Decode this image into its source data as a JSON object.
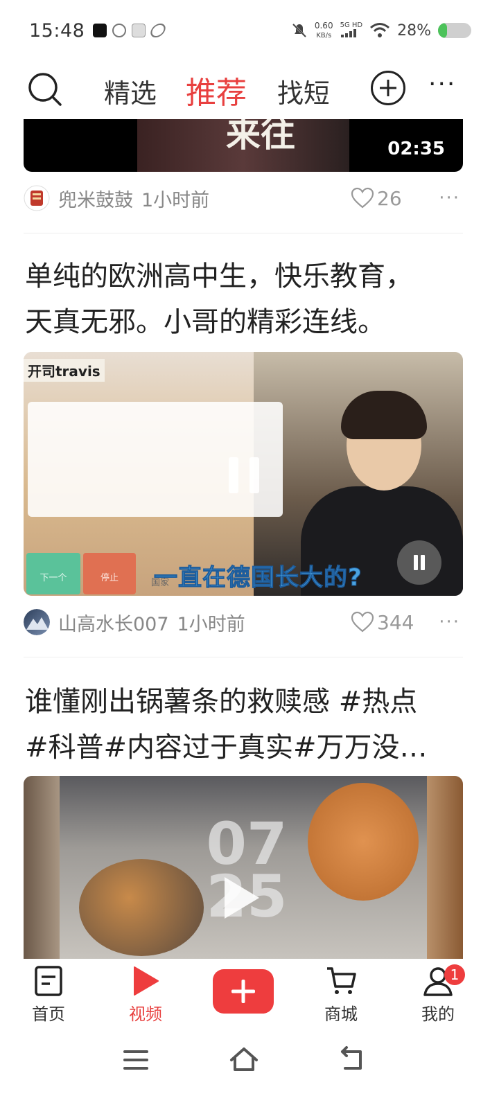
{
  "status_bar": {
    "time": "15:48",
    "net_speed": "0.60",
    "net_unit": "KB/s",
    "network": "5G HD",
    "battery": "28%"
  },
  "top_nav": {
    "tabs": [
      "精选",
      "推荐",
      "找短"
    ],
    "active_tab": "推荐",
    "icons": [
      "search-icon",
      "add-circle-icon",
      "more-icon"
    ]
  },
  "feed": [
    {
      "duration": "02:35",
      "thumb_text": "来往",
      "author": "兜米鼓鼓",
      "time": "1小时前",
      "likes": "26"
    },
    {
      "title_line1": "单纯的欧洲高中生，快乐教育，",
      "title_line2": "天真无邪。小哥的精彩连线。",
      "channel_tag": "开司travis",
      "subtitle": "一直在德国长大的?",
      "btn_next": "下一个",
      "btn_stop": "停止",
      "country_label": "国家",
      "author": "山高水长007",
      "time": "1小时前",
      "likes": "344"
    },
    {
      "title_line1": "谁懂刚出锅薯条的救赎感 #热点",
      "title_line2": "#科普#内容过于真实#万万没…",
      "overlay_number": "07 25"
    }
  ],
  "tabbar": {
    "items": [
      {
        "label": "首页",
        "icon": "home-doc-icon"
      },
      {
        "label": "视频",
        "icon": "video-play-icon"
      },
      {
        "label": "",
        "icon": "plus-icon"
      },
      {
        "label": "商城",
        "icon": "cart-icon"
      },
      {
        "label": "我的",
        "icon": "user-icon"
      }
    ],
    "active": "视频",
    "badge": "1"
  },
  "colors": {
    "accent": "#e8403f",
    "badge": "#ee3d3e"
  }
}
